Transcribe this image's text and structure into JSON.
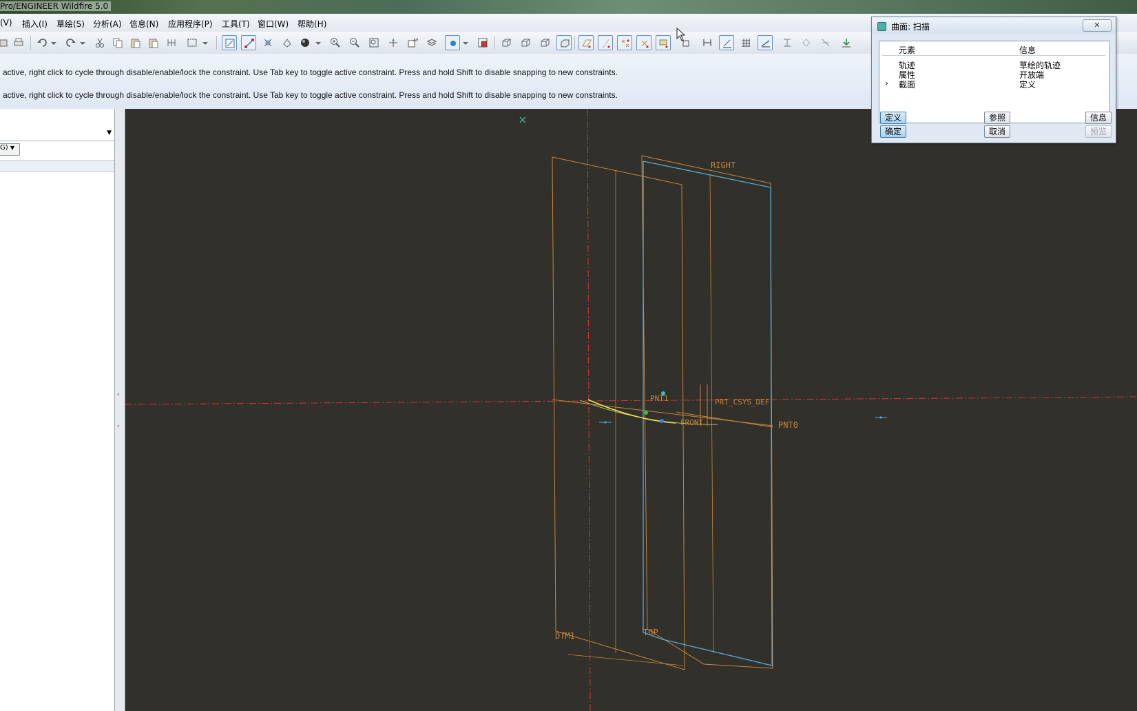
{
  "window": {
    "title": "Pro/ENGINEER Wildfire 5.0"
  },
  "menu": {
    "items": [
      "(V)",
      "插入(I)",
      "草绘(S)",
      "分析(A)",
      "信息(N)",
      "应用程序(P)",
      "工具(T)",
      "窗口(W)",
      "帮助(H)"
    ]
  },
  "messages": {
    "line1": "active, right click to cycle through disable/enable/lock the constraint. Use Tab key to toggle active constraint. Press and hold Shift to disable snapping to new constraints.",
    "line2": "active, right click to cycle through disable/enable/lock the constraint. Use Tab key to toggle active constraint. Press and hold Shift to disable snapping to new constraints."
  },
  "left_panel": {
    "combo2_text": "G)"
  },
  "viewport": {
    "labels": {
      "right": "RIGHT",
      "top": "TOP",
      "dtm1": "DTM1",
      "pnt0": "PNT0",
      "pnt1": "PNT1",
      "csys": "PRT_CSYS_DEF",
      "front": "FRONT"
    },
    "colors": {
      "background": "#31302b",
      "datum_orange": "#c8863e",
      "plane_blue": "#5aa9d4",
      "centerline_red": "#d23b2a",
      "trajectory_yellow": "#e8e05a"
    }
  },
  "dialog": {
    "title": "曲面: 扫描",
    "close_label": "✕",
    "columns": [
      "元素",
      "信息"
    ],
    "rows": [
      {
        "element": "轨迹",
        "info": "草绘的轨迹",
        "marker": ""
      },
      {
        "element": "属性",
        "info": "开放端",
        "marker": ""
      },
      {
        "element": "截面",
        "info": "定义",
        "marker": "›"
      }
    ],
    "buttons": {
      "define": "定义",
      "refs": "参照",
      "info": "信息",
      "ok": "确定",
      "cancel": "取消",
      "preview": "预览"
    }
  }
}
